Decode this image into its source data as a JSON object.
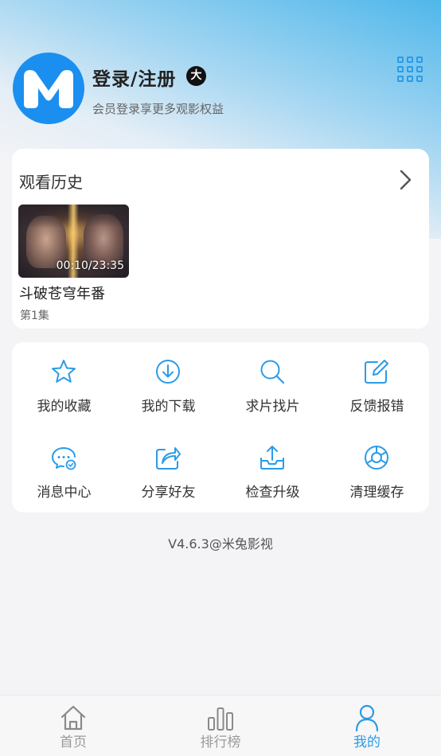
{
  "profile": {
    "login_title": "登录/注册",
    "vip_badge": "大",
    "subtitle": "会员登录享更多观影权益",
    "avatar_icon": "app-logo-m",
    "grid_icon": "grid-icon"
  },
  "history": {
    "title": "观看历史",
    "items": [
      {
        "title": "斗破苍穹年番",
        "episode": "第1集",
        "time": "00:10/23:35"
      }
    ]
  },
  "menu": {
    "items": [
      {
        "label": "我的收藏",
        "icon": "star-icon"
      },
      {
        "label": "我的下载",
        "icon": "download-icon"
      },
      {
        "label": "求片找片",
        "icon": "search-icon"
      },
      {
        "label": "反馈报错",
        "icon": "edit-icon"
      },
      {
        "label": "消息中心",
        "icon": "message-icon"
      },
      {
        "label": "分享好友",
        "icon": "share-icon"
      },
      {
        "label": "检查升级",
        "icon": "upload-icon"
      },
      {
        "label": "清理缓存",
        "icon": "clear-cache-icon"
      }
    ]
  },
  "version": "V4.6.3@米兔影视",
  "tabbar": {
    "items": [
      {
        "label": "首页",
        "icon": "home-icon",
        "active": false
      },
      {
        "label": "排行榜",
        "icon": "ranking-icon",
        "active": false
      },
      {
        "label": "我的",
        "icon": "user-icon",
        "active": true
      }
    ]
  },
  "colors": {
    "accent": "#2a9be8",
    "inactive": "#9a9a9a",
    "avatar_bg": "#1a8ff0"
  }
}
